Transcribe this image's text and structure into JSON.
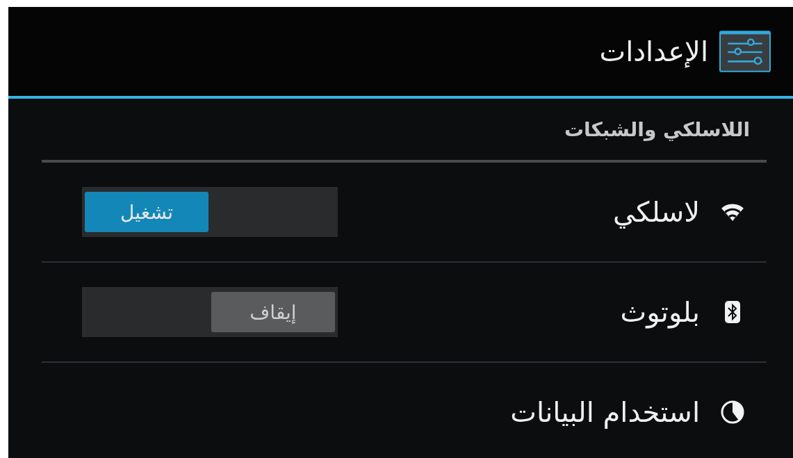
{
  "header": {
    "title": "الإعدادات"
  },
  "section": {
    "title": "اللاسلكي والشبكات"
  },
  "items": [
    {
      "kind": "toggle",
      "label": "لاسلكي",
      "toggle": {
        "on": true,
        "label": "تشغيل"
      }
    },
    {
      "kind": "toggle",
      "label": "بلوتوث",
      "toggle": {
        "on": false,
        "label": "إيقاف"
      }
    },
    {
      "kind": "plain",
      "label": "استخدام البيانات"
    }
  ]
}
